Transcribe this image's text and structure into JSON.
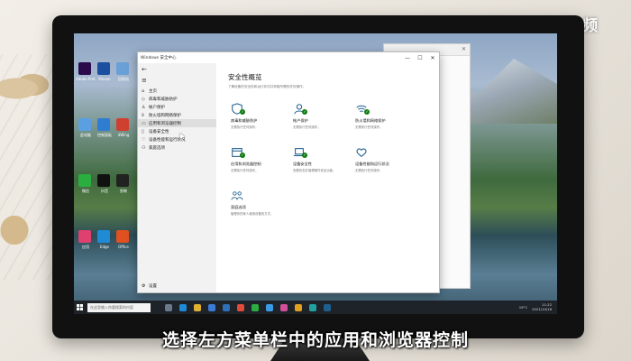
{
  "watermark": "天奇·视频",
  "caption": "选择左方菜单栏中的应用和浏览器控制",
  "window": {
    "title": "Windows 安全中心",
    "controls": {
      "minimize": "—",
      "maximize": "☐",
      "close": "✕"
    }
  },
  "sidebar": {
    "back": "←",
    "menu": "≡",
    "items": [
      {
        "icon": "⌂",
        "label": "主页",
        "name": "home"
      },
      {
        "icon": "◇",
        "label": "病毒和威胁防护",
        "name": "virus-protection"
      },
      {
        "icon": "♙",
        "label": "帐户保护",
        "name": "account-protection"
      },
      {
        "icon": "⌾",
        "label": "防火墙和网络保护",
        "name": "firewall"
      },
      {
        "icon": "▭",
        "label": "应用和浏览器控制",
        "name": "app-browser-control",
        "active": true
      },
      {
        "icon": "▯",
        "label": "设备安全性",
        "name": "device-security"
      },
      {
        "icon": "♡",
        "label": "设备性能和运行状况",
        "name": "device-performance"
      },
      {
        "icon": "⚇",
        "label": "家庭选项",
        "name": "family-options"
      }
    ],
    "settings": {
      "icon": "⚙",
      "label": "设置"
    }
  },
  "content": {
    "title": "安全性概览",
    "subtitle": "了解设备的安全性和运行状况并采取所需的任何操作。",
    "tiles": [
      {
        "name": "病毒和威胁防护",
        "desc": "无需执行任何操作。",
        "icon": "shield-icon",
        "badge": true
      },
      {
        "name": "帐户保护",
        "desc": "无需执行任何操作。",
        "icon": "person-icon",
        "badge": true
      },
      {
        "name": "防火墙和网络保护",
        "desc": "无需执行任何操作。",
        "icon": "wifi-icon",
        "badge": true
      },
      {
        "name": "应用和浏览器控制",
        "desc": "无需执行任何操作。",
        "icon": "browser-icon",
        "badge": true
      },
      {
        "name": "设备安全性",
        "desc": "查看状态并管理硬件安全功能。",
        "icon": "laptop-icon",
        "badge": true
      },
      {
        "name": "设备性能和运行状况",
        "desc": "无需执行任何操作。",
        "icon": "heart-icon",
        "badge": false
      },
      {
        "name": "家庭选项",
        "desc": "管理你的家人使用设备的方式。",
        "icon": "family-icon",
        "badge": false
      }
    ]
  },
  "taskbar": {
    "search_placeholder": "在这里输入你要搜索的内容",
    "temperature": "19°C",
    "time": "11:22",
    "date": "2021/10/18"
  },
  "desktop_icons": [
    {
      "label": "Adobe Premiere",
      "color": "#2a0a4a"
    },
    {
      "label": "Maxon",
      "color": "#1c4fa0"
    },
    {
      "label": "回收站",
      "color": "#6aa0d8"
    },
    {
      "label": "此电脑",
      "color": "#5aa0e0"
    },
    {
      "label": "控制面板",
      "color": "#2f7dd1"
    },
    {
      "label": "dWing",
      "color": "#d04030"
    },
    {
      "label": "微信",
      "color": "#2aae40"
    },
    {
      "label": "抖音",
      "color": "#111111"
    },
    {
      "label": "剪映",
      "color": "#222222"
    },
    {
      "label": "应用",
      "color": "#e04070"
    },
    {
      "label": "Edge",
      "color": "#1f8ad6"
    },
    {
      "label": "Office",
      "color": "#e05020"
    }
  ],
  "colors": {
    "accent_green": "#0f7b0f",
    "sidebar_bg": "#f2f2f2",
    "active_item": "#dedede",
    "icon_blue": "#1f5f8f"
  }
}
